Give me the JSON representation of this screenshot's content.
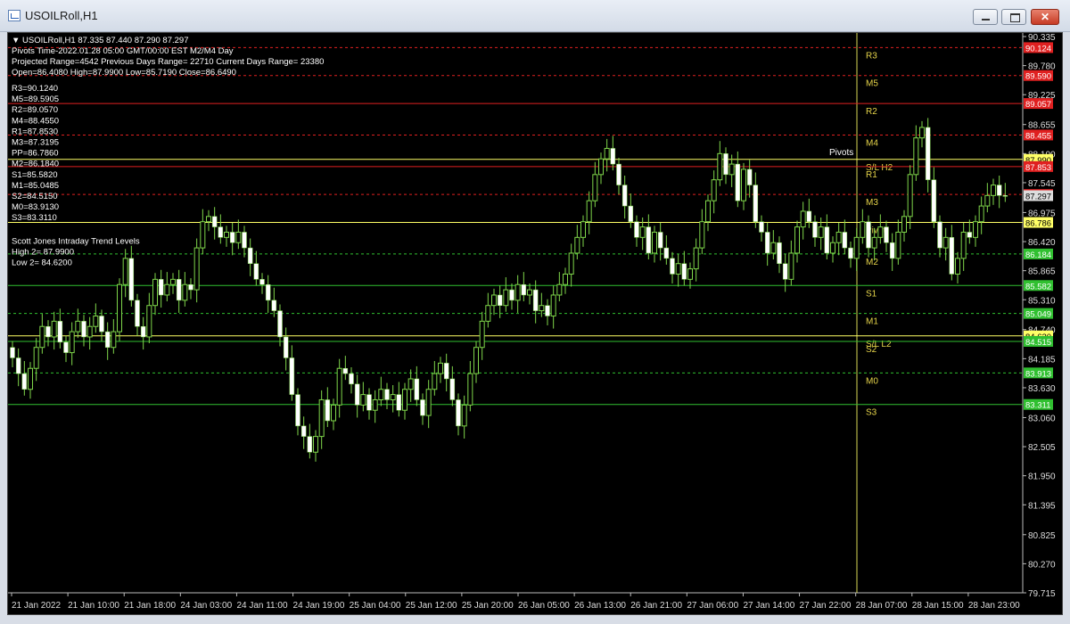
{
  "window": {
    "title": "USOILRoll,H1",
    "min_label": "",
    "max_label": "",
    "close_label": "✕"
  },
  "header_lines": [
    "▼ USOILRoll,H1  87.335 87.440 87.290 87.297",
    "Pivots Time-2022.01.28 05:00 GMT/00:00 EST M2/M4 Day",
    "Projected Range=4542 Previous Days Range= 22710 Current Days Range= 23380",
    "Open=86.4080 High=87.9900 Low=85.7190 Close=86.6490"
  ],
  "pivot_list": [
    "R3=90.1240",
    "M5=89.5905",
    "R2=89.0570",
    "M4=88.4550",
    "R1=87.8530",
    "M3=87.3195",
    "PP=86.7860",
    "M2=86.1840",
    "S1=85.5820",
    "M1=85.0485",
    "S2=84.5150",
    "M0=83.9130",
    "S3=83.3110"
  ],
  "trend_lines": [
    "Scott Jones Intraday Trend Levels",
    "High 2= 87.9900",
    "Low 2= 84.6200"
  ],
  "colors": {
    "background": "#000000",
    "text": "#ffffff",
    "candle_up": "#ffffff",
    "candle_down": "#ffffff",
    "wick": "#7fd64a",
    "resistance": "#e02020",
    "support": "#30c030",
    "pivot": "#ffff66",
    "pivot_text": "#e6d44a"
  },
  "chart_data": {
    "type": "candlestick",
    "symbol": "USOILRoll",
    "timeframe": "H1",
    "ylim": [
      79.715,
      90.335
    ],
    "y_ticks": [
      "90.335",
      "89.780",
      "89.225",
      "88.655",
      "88.100",
      "87.545",
      "86.975",
      "86.420",
      "85.865",
      "85.310",
      "84.740",
      "84.185",
      "83.630",
      "83.060",
      "82.505",
      "81.950",
      "81.395",
      "80.825",
      "80.270",
      "79.715"
    ],
    "x_ticks": [
      "21 Jan 2022",
      "21 Jan 10:00",
      "21 Jan 18:00",
      "24 Jan 03:00",
      "24 Jan 11:00",
      "24 Jan 19:00",
      "25 Jan 04:00",
      "25 Jan 12:00",
      "25 Jan 20:00",
      "26 Jan 05:00",
      "26 Jan 13:00",
      "26 Jan 21:00",
      "27 Jan 06:00",
      "27 Jan 14:00",
      "27 Jan 22:00",
      "28 Jan 07:00",
      "28 Jan 15:00",
      "28 Jan 23:00"
    ],
    "pivot_levels": [
      {
        "name": "R3",
        "value": 90.124,
        "label": "90.124",
        "kind": "resistance",
        "style": "dashed",
        "marker": "R3"
      },
      {
        "name": "M5",
        "value": 89.5905,
        "label": "89.590",
        "kind": "resistance",
        "style": "dashed",
        "marker": "M5"
      },
      {
        "name": "R2",
        "value": 89.057,
        "label": "89.057",
        "kind": "resistance",
        "style": "solid",
        "marker": "R2"
      },
      {
        "name": "M4",
        "value": 88.455,
        "label": "88.455",
        "kind": "resistance",
        "style": "dashed",
        "marker": "M4"
      },
      {
        "name": "High2",
        "value": 87.99,
        "label": "87.990",
        "kind": "trend",
        "style": "solid",
        "marker": "S/L H2"
      },
      {
        "name": "R1",
        "value": 87.853,
        "label": "87.853",
        "kind": "resistance",
        "style": "solid",
        "marker": "R1"
      },
      {
        "name": "M3",
        "value": 87.3195,
        "label": "87.320",
        "kind": "resistance",
        "style": "dashed",
        "marker": "M3"
      },
      {
        "name": "PP",
        "value": 86.786,
        "label": "86.786",
        "kind": "pivot",
        "style": "solid",
        "marker": "Pivot"
      },
      {
        "name": "M2",
        "value": 86.184,
        "label": "86.184",
        "kind": "support",
        "style": "dashed",
        "marker": "M2"
      },
      {
        "name": "S1",
        "value": 85.582,
        "label": "85.582",
        "kind": "support",
        "style": "solid",
        "marker": "S1"
      },
      {
        "name": "M1",
        "value": 85.0485,
        "label": "85.049",
        "kind": "support",
        "style": "dashed",
        "marker": "M1"
      },
      {
        "name": "Low2",
        "value": 84.62,
        "label": "84.620",
        "kind": "trend",
        "style": "solid",
        "marker": "S/L L2"
      },
      {
        "name": "S2",
        "value": 84.515,
        "label": "84.515",
        "kind": "support",
        "style": "solid",
        "marker": "S2"
      },
      {
        "name": "M0",
        "value": 83.913,
        "label": "83.913",
        "kind": "support",
        "style": "dashed",
        "marker": "M0"
      },
      {
        "name": "S3",
        "value": 83.311,
        "label": "83.311",
        "kind": "support",
        "style": "solid",
        "marker": "S3"
      }
    ],
    "pivots_label": "Pivots",
    "close_marker": "87.297",
    "closes": [
      84.2,
      83.9,
      83.6,
      84.0,
      84.4,
      84.8,
      84.6,
      84.9,
      84.5,
      84.3,
      84.7,
      84.9,
      84.6,
      84.8,
      85.0,
      84.7,
      84.4,
      84.7,
      85.6,
      86.1,
      85.3,
      84.8,
      84.6,
      85.2,
      85.7,
      85.4,
      85.6,
      85.7,
      85.3,
      85.6,
      85.5,
      86.3,
      86.8,
      86.9,
      86.7,
      86.5,
      86.6,
      86.4,
      86.6,
      86.3,
      86.0,
      85.7,
      85.6,
      85.3,
      85.1,
      84.6,
      84.2,
      83.5,
      82.9,
      82.7,
      82.4,
      82.7,
      83.4,
      83.0,
      83.3,
      84.0,
      83.9,
      83.7,
      83.3,
      83.5,
      83.2,
      83.4,
      83.6,
      83.4,
      83.5,
      83.2,
      83.6,
      83.8,
      83.4,
      83.1,
      83.6,
      83.9,
      84.1,
      83.8,
      83.4,
      82.9,
      83.3,
      83.9,
      84.4,
      84.9,
      85.2,
      85.4,
      85.2,
      85.5,
      85.3,
      85.6,
      85.4,
      85.5,
      85.1,
      85.2,
      85.0,
      85.4,
      85.6,
      85.8,
      86.2,
      86.5,
      86.8,
      87.2,
      87.7,
      88.0,
      88.2,
      87.9,
      87.5,
      87.1,
      86.8,
      86.5,
      86.7,
      86.2,
      86.6,
      86.3,
      86.1,
      85.8,
      86.0,
      85.7,
      85.9,
      86.3,
      86.8,
      87.2,
      87.6,
      88.1,
      87.7,
      87.9,
      87.2,
      87.8,
      87.5,
      86.8,
      86.6,
      86.2,
      86.4,
      86.0,
      85.7,
      86.2,
      86.7,
      87.0,
      86.8,
      86.5,
      86.7,
      86.2,
      86.4,
      86.6,
      86.3,
      86.1,
      86.5,
      86.8,
      86.3,
      86.5,
      86.7,
      86.4,
      86.1,
      86.6,
      86.9,
      87.7,
      88.4,
      88.6,
      87.6,
      86.8,
      86.3,
      86.5,
      85.8,
      86.1,
      86.6,
      86.5,
      86.8,
      87.1,
      87.3,
      87.5,
      87.3,
      87.297
    ]
  }
}
